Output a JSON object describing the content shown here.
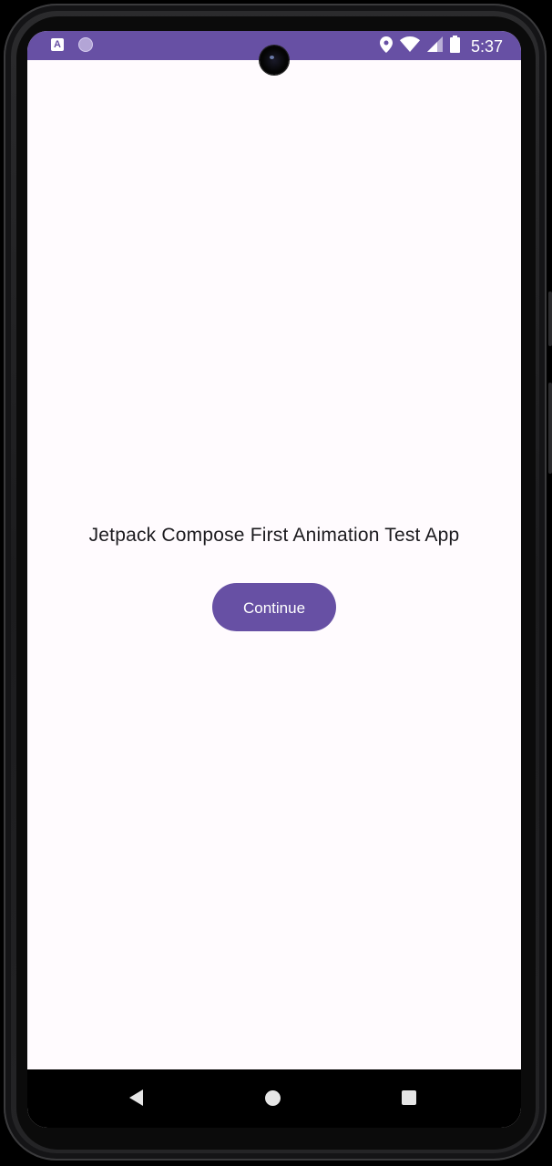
{
  "status_bar": {
    "time": "5:37",
    "notification_icons": [
      "app-notification-icon",
      "sync-circle-icon"
    ],
    "system_icons": [
      "location-icon",
      "wifi-icon",
      "signal-icon",
      "battery-icon"
    ],
    "color": "#6750a4"
  },
  "main": {
    "title": "Jetpack Compose First Animation Test App",
    "continue_label": "Continue"
  },
  "navigation_bar": {
    "buttons": [
      "back",
      "home",
      "recents"
    ]
  },
  "theme": {
    "primary": "#6750a4",
    "background": "#fffbfe",
    "on_background": "#1c1b1f"
  }
}
